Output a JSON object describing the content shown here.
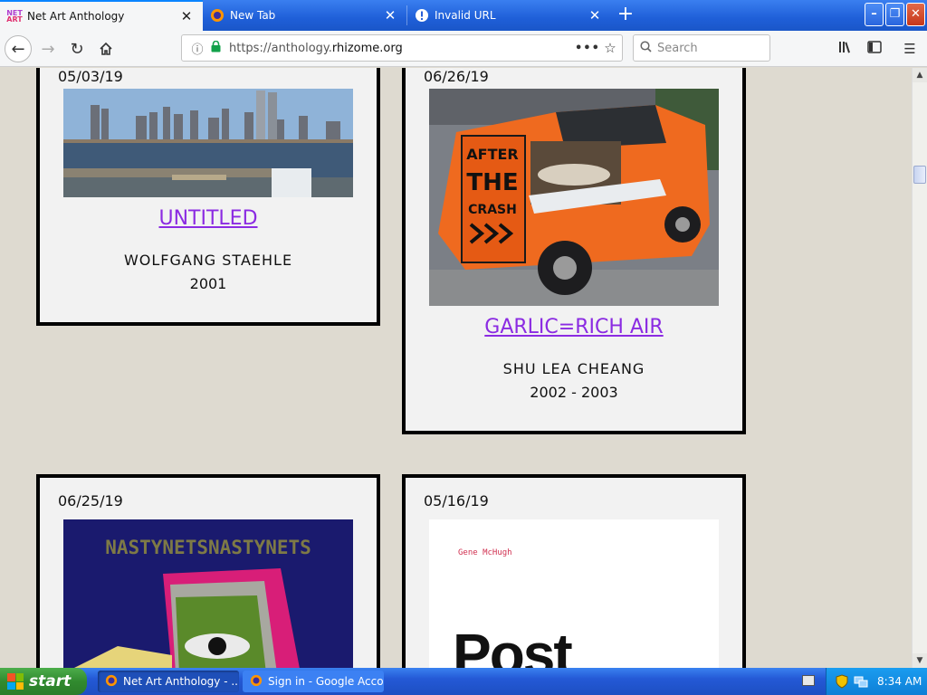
{
  "browser": {
    "tabs": [
      {
        "title": "Net Art Anthology",
        "favicon": "net-art-logo",
        "favicon_text": "NET ART",
        "active": true
      },
      {
        "title": "New Tab",
        "favicon": "firefox-icon",
        "active": false
      },
      {
        "title": "Invalid URL",
        "favicon": "warning-icon",
        "active": false
      }
    ],
    "new_tab_label": "+",
    "url_scheme": "https://anthology.",
    "url_host": "rhizome.org",
    "search_placeholder": "Search"
  },
  "cards": [
    {
      "date": "05/03/19",
      "title": "UNTITLED",
      "artist": "WOLFGANG STAEHLE",
      "year": "2001",
      "image": "new-york-skyline-photo"
    },
    {
      "date": "06/26/19",
      "title": "GARLIC=RICH AIR",
      "artist": "SHU LEA CHEANG",
      "year": "2002 - 2003",
      "image": "orange-truck-photo",
      "truck_text": [
        "AFTER",
        "THE",
        "CRASH"
      ]
    },
    {
      "date": "06/25/19",
      "image": "nastynets-graphic",
      "image_text": "NASTYNETSNASTYNETS"
    },
    {
      "date": "05/16/19",
      "image": "postinternet-book-cover",
      "image_text_author": "Gene McHugh",
      "image_text_title": "Post"
    }
  ],
  "taskbar": {
    "start_label": "start",
    "items": [
      {
        "label": "Net Art Anthology - ...",
        "active": true
      },
      {
        "label": "Sign in - Google Acco...",
        "active": false
      }
    ],
    "clock": "8:34 AM"
  },
  "colors": {
    "page_background": "#dedad0",
    "card_background": "#f2f2f2",
    "link": "#8b2be2",
    "xp_blue": "#245edb"
  }
}
